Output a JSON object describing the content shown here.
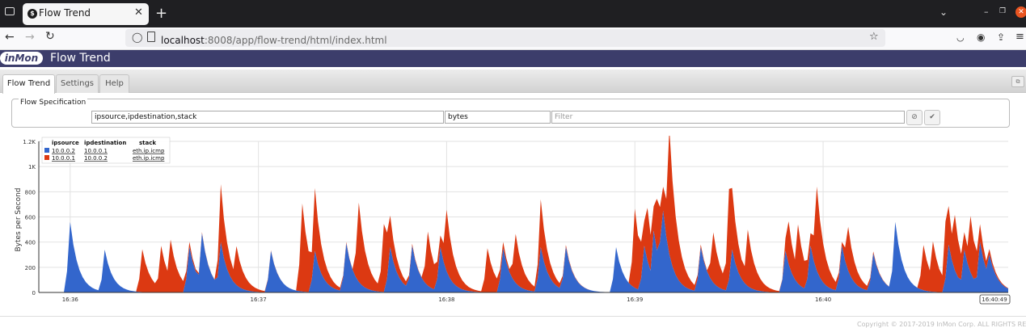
{
  "browser": {
    "tab_title": "Flow Trend",
    "url_host": "localhost",
    "url_rest": ":8008/app/flow-trend/html/index.html"
  },
  "app": {
    "logo": "inMon",
    "title": "Flow Trend",
    "tabs": [
      "Flow Trend",
      "Settings",
      "Help"
    ]
  },
  "flow_spec": {
    "legend": "Flow Specification",
    "keys": "ipsource,ipdestination,stack",
    "value": "bytes",
    "filter_placeholder": "Filter"
  },
  "colors": {
    "blue": "#3366cc",
    "red": "#dc3912"
  },
  "chart_data": {
    "type": "area",
    "ylabel": "Bytes per Second",
    "yticks": [
      0,
      200,
      400,
      600,
      800,
      "1K",
      "1.2K"
    ],
    "ylim": [
      0,
      1200
    ],
    "xticks": [
      "16:36",
      "16:37",
      "16:38",
      "16:39",
      "16:40"
    ],
    "end_label": "16:40:49",
    "legend": {
      "headers": [
        "ipsource",
        "ipdestination",
        "stack"
      ],
      "rows": [
        [
          "10.0.0.2",
          "10.0.0.1",
          "eth.ip.icmp"
        ],
        [
          "10.0.0.1",
          "10.0.0.2",
          "eth.ip.icmp"
        ]
      ]
    },
    "series": [
      {
        "name": "10.0.0.2 10.0.0.1 eth.ip.icmp",
        "color": "#3366cc",
        "peaks": [
          [
            10,
            560
          ],
          [
            21,
            340
          ],
          [
            48,
            360
          ],
          [
            52,
            470
          ],
          [
            58,
            400
          ],
          [
            74,
            330
          ],
          [
            88,
            330
          ],
          [
            98,
            390
          ],
          [
            112,
            360
          ],
          [
            119,
            370
          ],
          [
            128,
            360
          ],
          [
            148,
            350
          ],
          [
            160,
            360
          ],
          [
            168,
            360
          ],
          [
            184,
            360
          ],
          [
            193,
            370
          ],
          [
            196,
            490
          ],
          [
            198,
            400
          ],
          [
            199,
            650
          ],
          [
            211,
            360
          ],
          [
            221,
            340
          ],
          [
            238,
            330
          ],
          [
            246,
            370
          ],
          [
            256,
            370
          ],
          [
            266,
            310
          ],
          [
            273,
            560
          ],
          [
            290,
            380
          ],
          [
            295,
            340
          ],
          [
            300,
            400
          ],
          [
            303,
            300
          ]
        ]
      },
      {
        "name": "10.0.0.1 10.0.0.2 eth.ip.icmp",
        "color": "#dc3912",
        "peaks": [
          [
            33,
            340
          ],
          [
            39,
            370
          ],
          [
            42,
            420
          ],
          [
            58,
            460
          ],
          [
            63,
            310
          ],
          [
            84,
            700
          ],
          [
            88,
            500
          ],
          [
            102,
            630
          ],
          [
            110,
            540
          ],
          [
            124,
            430
          ],
          [
            130,
            490
          ],
          [
            143,
            350
          ],
          [
            152,
            390
          ],
          [
            160,
            380
          ],
          [
            190,
            630
          ],
          [
            194,
            420
          ],
          [
            197,
            410
          ],
          [
            201,
            1000
          ],
          [
            215,
            400
          ],
          [
            220,
            720
          ],
          [
            226,
            450
          ],
          [
            239,
            340
          ],
          [
            242,
            470
          ],
          [
            248,
            670
          ],
          [
            258,
            350
          ],
          [
            282,
            360
          ],
          [
            285,
            400
          ],
          [
            289,
            450
          ],
          [
            292,
            440
          ],
          [
            297,
            450
          ]
        ]
      }
    ]
  },
  "footer": {
    "copyright": "Copyright © 2017-2019 InMon Corp. ALL RIGHTS RESERVED"
  }
}
